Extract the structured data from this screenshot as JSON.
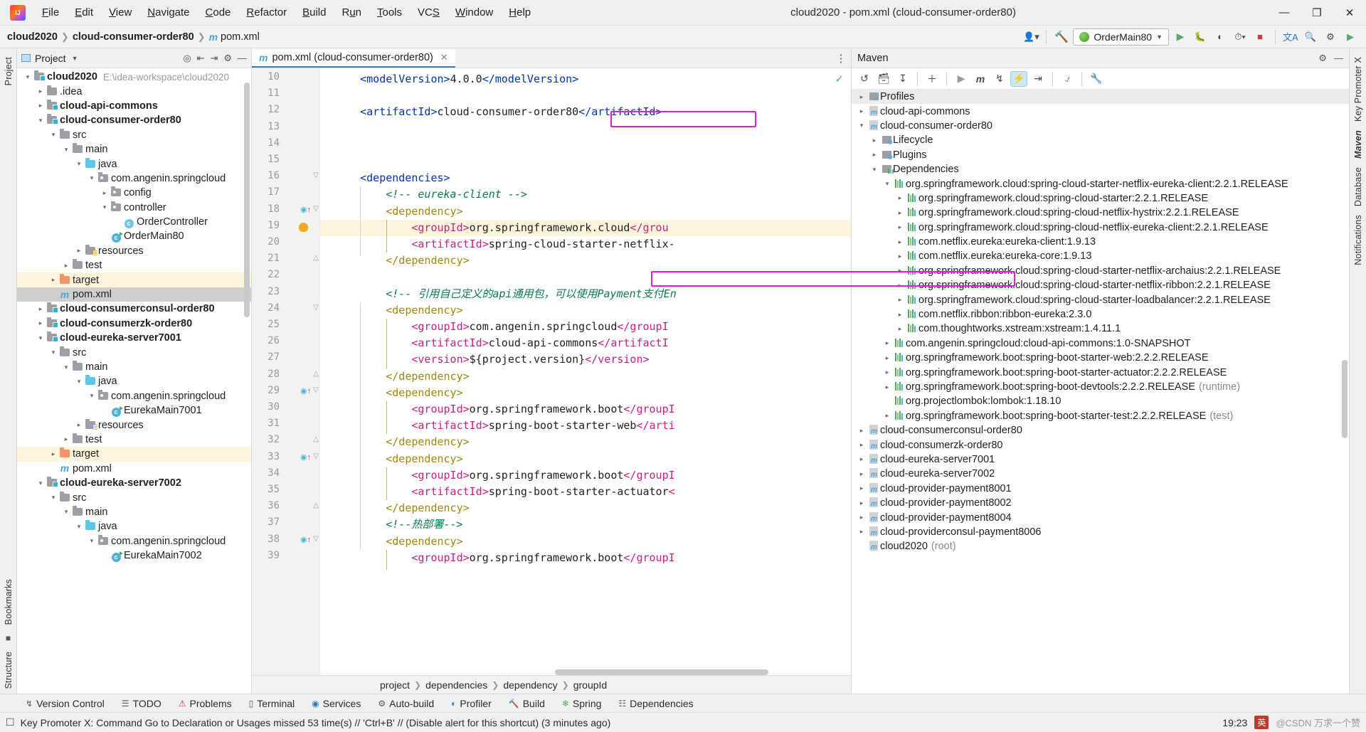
{
  "window": {
    "title": "cloud2020 - pom.xml (cloud-consumer-order80)",
    "minimize": "—",
    "maximize": "❐",
    "close": "✕"
  },
  "menubar": [
    "File",
    "Edit",
    "View",
    "Navigate",
    "Code",
    "Refactor",
    "Build",
    "Run",
    "Tools",
    "VCS",
    "Window",
    "Help"
  ],
  "navbar": {
    "crumbs": [
      "cloud2020",
      "cloud-consumer-order80",
      "pom.xml"
    ],
    "run_config": "OrderMain80",
    "icons": [
      "user-icon",
      "hammer-icon",
      "run-icon",
      "debug-icon",
      "coverage-icon",
      "profile-icon",
      "stop-icon",
      "translate-icon",
      "search-icon",
      "settings-icon",
      "expand-icon"
    ]
  },
  "rails": {
    "left_top": "Project",
    "left_bottom": "Bookmarks",
    "left_bottom2": "Structure",
    "right": [
      "Key Promoter X",
      "Maven",
      "Database",
      "Notifications"
    ]
  },
  "project_panel": {
    "title": "Project",
    "tools": [
      "target-icon",
      "collapse-icon",
      "expand-icon",
      "gear-icon",
      "hide-icon"
    ],
    "tree": [
      {
        "indent": 0,
        "arrow": "v",
        "icon": "module-folder",
        "label": "cloud2020",
        "bold": true,
        "path": "E:\\idea-workspace\\cloud2020"
      },
      {
        "indent": 1,
        "arrow": ">",
        "icon": "folder",
        "label": ".idea",
        "bold": false
      },
      {
        "indent": 1,
        "arrow": ">",
        "icon": "module-folder",
        "label": "cloud-api-commons",
        "bold": true
      },
      {
        "indent": 1,
        "arrow": "v",
        "icon": "module-folder",
        "label": "cloud-consumer-order80",
        "bold": true
      },
      {
        "indent": 2,
        "arrow": "v",
        "icon": "folder",
        "label": "src",
        "bold": false
      },
      {
        "indent": 3,
        "arrow": "v",
        "icon": "folder",
        "label": "main",
        "bold": false
      },
      {
        "indent": 4,
        "arrow": "v",
        "icon": "source-folder",
        "label": "java",
        "bold": false
      },
      {
        "indent": 5,
        "arrow": "v",
        "icon": "package",
        "label": "com.angenin.springcloud",
        "bold": false
      },
      {
        "indent": 6,
        "arrow": ">",
        "icon": "package",
        "label": "config",
        "bold": false
      },
      {
        "indent": 6,
        "arrow": "v",
        "icon": "package",
        "label": "controller",
        "bold": false
      },
      {
        "indent": 7,
        "arrow": "",
        "icon": "class",
        "label": "OrderController",
        "bold": false
      },
      {
        "indent": 6,
        "arrow": "",
        "icon": "runnable-class",
        "label": "OrderMain80",
        "bold": false
      },
      {
        "indent": 4,
        "arrow": ">",
        "icon": "resource-folder",
        "label": "resources",
        "bold": false
      },
      {
        "indent": 3,
        "arrow": ">",
        "icon": "folder",
        "label": "test",
        "bold": false
      },
      {
        "indent": 2,
        "arrow": ">",
        "icon": "target-folder",
        "label": "target",
        "bold": false,
        "highlight": true
      },
      {
        "indent": 2,
        "arrow": "",
        "icon": "maven-file",
        "label": "pom.xml",
        "bold": false,
        "selected": true
      },
      {
        "indent": 1,
        "arrow": ">",
        "icon": "module-folder",
        "label": "cloud-consumerconsul-order80",
        "bold": true
      },
      {
        "indent": 1,
        "arrow": ">",
        "icon": "module-folder",
        "label": "cloud-consumerzk-order80",
        "bold": true
      },
      {
        "indent": 1,
        "arrow": "v",
        "icon": "module-folder",
        "label": "cloud-eureka-server7001",
        "bold": true
      },
      {
        "indent": 2,
        "arrow": "v",
        "icon": "folder",
        "label": "src",
        "bold": false
      },
      {
        "indent": 3,
        "arrow": "v",
        "icon": "folder",
        "label": "main",
        "bold": false
      },
      {
        "indent": 4,
        "arrow": "v",
        "icon": "source-folder",
        "label": "java",
        "bold": false
      },
      {
        "indent": 5,
        "arrow": "v",
        "icon": "package",
        "label": "com.angenin.springcloud",
        "bold": false
      },
      {
        "indent": 6,
        "arrow": "",
        "icon": "runnable-class",
        "label": "EurekaMain7001",
        "bold": false
      },
      {
        "indent": 4,
        "arrow": ">",
        "icon": "resource-folder",
        "label": "resources",
        "bold": false
      },
      {
        "indent": 3,
        "arrow": ">",
        "icon": "folder",
        "label": "test",
        "bold": false
      },
      {
        "indent": 2,
        "arrow": ">",
        "icon": "target-folder",
        "label": "target",
        "bold": false,
        "highlight": true
      },
      {
        "indent": 2,
        "arrow": "",
        "icon": "maven-file",
        "label": "pom.xml",
        "bold": false
      },
      {
        "indent": 1,
        "arrow": "v",
        "icon": "module-folder",
        "label": "cloud-eureka-server7002",
        "bold": true
      },
      {
        "indent": 2,
        "arrow": "v",
        "icon": "folder",
        "label": "src",
        "bold": false
      },
      {
        "indent": 3,
        "arrow": "v",
        "icon": "folder",
        "label": "main",
        "bold": false
      },
      {
        "indent": 4,
        "arrow": "v",
        "icon": "source-folder",
        "label": "java",
        "bold": false
      },
      {
        "indent": 5,
        "arrow": "v",
        "icon": "package",
        "label": "com.angenin.springcloud",
        "bold": false
      },
      {
        "indent": 6,
        "arrow": "",
        "icon": "runnable-class",
        "label": "EurekaMain7002",
        "bold": false
      }
    ]
  },
  "editor": {
    "tab_label": "pom.xml (cloud-consumer-order80)",
    "tab_icon": "maven-file-icon",
    "close_icon": "✕",
    "inspection_status": "✓",
    "lines": [
      {
        "n": 10,
        "parts": [
          {
            "t": "    <modelVersion>",
            "c": "tg"
          },
          {
            "t": "4.0.0",
            "c": "txt"
          },
          {
            "t": "</modelVersion>",
            "c": "tg"
          }
        ]
      },
      {
        "n": 11,
        "parts": []
      },
      {
        "n": 12,
        "parts": [
          {
            "t": "    <artifactId>",
            "c": "tg"
          },
          {
            "t": "cloud-consumer-order80",
            "c": "txt"
          },
          {
            "t": "</artifactId>",
            "c": "tg"
          }
        ]
      },
      {
        "n": 13,
        "parts": []
      },
      {
        "n": 14,
        "parts": []
      },
      {
        "n": 15,
        "parts": []
      },
      {
        "n": 16,
        "parts": [
          {
            "t": "    <dependencies>",
            "c": "tg"
          }
        ],
        "fold": "v"
      },
      {
        "n": 17,
        "parts": [
          {
            "t": "        <!-- eureka-client -->",
            "c": "cm"
          }
        ]
      },
      {
        "n": 18,
        "parts": [
          {
            "t": "        <dependency>",
            "c": "tg2"
          }
        ],
        "mark": "bookmark-arrow",
        "fold": "v"
      },
      {
        "n": 19,
        "parts": [
          {
            "t": "            <groupId>",
            "c": "tg3"
          },
          {
            "t": "org.springframework.cloud",
            "c": "txt"
          },
          {
            "t": "</grou",
            "c": "tg3"
          }
        ],
        "bulb": true,
        "highlight": true
      },
      {
        "n": 20,
        "parts": [
          {
            "t": "            <artifactId>",
            "c": "tg3"
          },
          {
            "t": "spring-cloud-starter-netflix-",
            "c": "txt"
          }
        ]
      },
      {
        "n": 21,
        "parts": [
          {
            "t": "        </dependency>",
            "c": "tg2"
          }
        ],
        "fold": "^"
      },
      {
        "n": 22,
        "parts": []
      },
      {
        "n": 23,
        "parts": [
          {
            "t": "        <!-- 引用自己定义的api通用包，可以使用Payment支付En",
            "c": "cm"
          }
        ]
      },
      {
        "n": 24,
        "parts": [
          {
            "t": "        <dependency>",
            "c": "tg2"
          }
        ],
        "fold": "v"
      },
      {
        "n": 25,
        "parts": [
          {
            "t": "            <groupId>",
            "c": "tg3"
          },
          {
            "t": "com.angenin.springcloud",
            "c": "txt"
          },
          {
            "t": "</groupI",
            "c": "tg3"
          }
        ]
      },
      {
        "n": 26,
        "parts": [
          {
            "t": "            <artifactId>",
            "c": "tg3"
          },
          {
            "t": "cloud-api-commons",
            "c": "txt"
          },
          {
            "t": "</artifactI",
            "c": "tg3"
          }
        ]
      },
      {
        "n": 27,
        "parts": [
          {
            "t": "            <version>",
            "c": "tg3"
          },
          {
            "t": "${project.version}",
            "c": "txt"
          },
          {
            "t": "</version>",
            "c": "tg3"
          }
        ]
      },
      {
        "n": 28,
        "parts": [
          {
            "t": "        </dependency>",
            "c": "tg2"
          }
        ],
        "fold": "^"
      },
      {
        "n": 29,
        "parts": [
          {
            "t": "        <dependency>",
            "c": "tg2"
          }
        ],
        "mark": "bookmark-arrow",
        "fold": "v"
      },
      {
        "n": 30,
        "parts": [
          {
            "t": "            <groupId>",
            "c": "tg3"
          },
          {
            "t": "org.springframework.boot",
            "c": "txt"
          },
          {
            "t": "</groupI",
            "c": "tg3"
          }
        ]
      },
      {
        "n": 31,
        "parts": [
          {
            "t": "            <artifactId>",
            "c": "tg3"
          },
          {
            "t": "spring-boot-starter-web",
            "c": "txt"
          },
          {
            "t": "</arti",
            "c": "tg3"
          }
        ]
      },
      {
        "n": 32,
        "parts": [
          {
            "t": "        </dependency>",
            "c": "tg2"
          }
        ],
        "fold": "^"
      },
      {
        "n": 33,
        "parts": [
          {
            "t": "        <dependency>",
            "c": "tg2"
          }
        ],
        "mark": "bookmark-arrow",
        "fold": "v"
      },
      {
        "n": 34,
        "parts": [
          {
            "t": "            <groupId>",
            "c": "tg3"
          },
          {
            "t": "org.springframework.boot",
            "c": "txt"
          },
          {
            "t": "</groupI",
            "c": "tg3"
          }
        ]
      },
      {
        "n": 35,
        "parts": [
          {
            "t": "            <artifactId>",
            "c": "tg3"
          },
          {
            "t": "spring-boot-starter-actuator",
            "c": "txt"
          },
          {
            "t": "<",
            "c": "tg3"
          }
        ]
      },
      {
        "n": 36,
        "parts": [
          {
            "t": "        </dependency>",
            "c": "tg2"
          }
        ],
        "fold": "^"
      },
      {
        "n": 37,
        "parts": [
          {
            "t": "        <!--热部署-->",
            "c": "cm"
          }
        ]
      },
      {
        "n": 38,
        "parts": [
          {
            "t": "        <dependency>",
            "c": "tg2"
          }
        ],
        "mark": "bookmark-arrow",
        "fold": "v"
      },
      {
        "n": 39,
        "parts": [
          {
            "t": "            <groupId>",
            "c": "tg3"
          },
          {
            "t": "org.springframework.boot",
            "c": "txt"
          },
          {
            "t": "</groupI",
            "c": "tg3"
          }
        ]
      }
    ],
    "breadcrumbs": [
      "project",
      "dependencies",
      "dependency",
      "groupId"
    ]
  },
  "maven": {
    "title": "Maven",
    "head_tools": [
      "gear-icon",
      "hide-icon"
    ],
    "toolbar_icons": [
      "reload-icon",
      "generate-sources-icon",
      "download-sources-icon",
      "add-icon",
      "run-icon",
      "execute-goal-icon",
      "toggle-skip-tests-icon",
      "toggle-offline-icon",
      "collapse-all-icon",
      "show-dependencies-icon",
      "settings-wrench-icon"
    ],
    "tree": [
      {
        "indent": 0,
        "arrow": ">",
        "icon": "profiles",
        "label": "Profiles",
        "selected": true
      },
      {
        "indent": 0,
        "arrow": ">",
        "icon": "maven-module",
        "label": "cloud-api-commons"
      },
      {
        "indent": 0,
        "arrow": "v",
        "icon": "maven-module",
        "label": "cloud-consumer-order80",
        "magenta": true
      },
      {
        "indent": 1,
        "arrow": ">",
        "icon": "lifecycle",
        "label": "Lifecycle"
      },
      {
        "indent": 1,
        "arrow": ">",
        "icon": "plugins",
        "label": "Plugins"
      },
      {
        "indent": 1,
        "arrow": "v",
        "icon": "dependencies",
        "label": "Dependencies"
      },
      {
        "indent": 2,
        "arrow": "v",
        "icon": "lib",
        "label": "org.springframework.cloud:spring-cloud-starter-netflix-eureka-client:2.2.1.RELEASE"
      },
      {
        "indent": 3,
        "arrow": ">",
        "icon": "lib",
        "label": "org.springframework.cloud:spring-cloud-starter:2.2.1.RELEASE"
      },
      {
        "indent": 3,
        "arrow": ">",
        "icon": "lib",
        "label": "org.springframework.cloud:spring-cloud-netflix-hystrix:2.2.1.RELEASE"
      },
      {
        "indent": 3,
        "arrow": ">",
        "icon": "lib",
        "label": "org.springframework.cloud:spring-cloud-netflix-eureka-client:2.2.1.RELEASE"
      },
      {
        "indent": 3,
        "arrow": ">",
        "icon": "lib",
        "label": "com.netflix.eureka:eureka-client:1.9.13"
      },
      {
        "indent": 3,
        "arrow": ">",
        "icon": "lib",
        "label": "com.netflix.eureka:eureka-core:1.9.13"
      },
      {
        "indent": 3,
        "arrow": ">",
        "icon": "lib",
        "label": "org.springframework.cloud:spring-cloud-starter-netflix-archaius:2.2.1.RELEASE"
      },
      {
        "indent": 3,
        "arrow": ">",
        "icon": "lib",
        "label": "org.springframework.cloud:spring-cloud-starter-netflix-ribbon:2.2.1.RELEASE",
        "magenta": true
      },
      {
        "indent": 3,
        "arrow": ">",
        "icon": "lib",
        "label": "org.springframework.cloud:spring-cloud-starter-loadbalancer:2.2.1.RELEASE"
      },
      {
        "indent": 3,
        "arrow": ">",
        "icon": "lib",
        "label": "com.netflix.ribbon:ribbon-eureka:2.3.0"
      },
      {
        "indent": 3,
        "arrow": ">",
        "icon": "lib",
        "label": "com.thoughtworks.xstream:xstream:1.4.11.1"
      },
      {
        "indent": 2,
        "arrow": ">",
        "icon": "lib",
        "label": "com.angenin.springcloud:cloud-api-commons:1.0-SNAPSHOT"
      },
      {
        "indent": 2,
        "arrow": ">",
        "icon": "lib",
        "label": "org.springframework.boot:spring-boot-starter-web:2.2.2.RELEASE"
      },
      {
        "indent": 2,
        "arrow": ">",
        "icon": "lib",
        "label": "org.springframework.boot:spring-boot-starter-actuator:2.2.2.RELEASE"
      },
      {
        "indent": 2,
        "arrow": ">",
        "icon": "lib",
        "label": "org.springframework.boot:spring-boot-devtools:2.2.2.RELEASE",
        "dim": "(runtime)"
      },
      {
        "indent": 2,
        "arrow": "",
        "icon": "lib",
        "label": "org.projectlombok:lombok:1.18.10"
      },
      {
        "indent": 2,
        "arrow": ">",
        "icon": "lib",
        "label": "org.springframework.boot:spring-boot-starter-test:2.2.2.RELEASE",
        "dim": "(test)"
      },
      {
        "indent": 0,
        "arrow": ">",
        "icon": "maven-module",
        "label": "cloud-consumerconsul-order80"
      },
      {
        "indent": 0,
        "arrow": ">",
        "icon": "maven-module",
        "label": "cloud-consumerzk-order80"
      },
      {
        "indent": 0,
        "arrow": ">",
        "icon": "maven-module",
        "label": "cloud-eureka-server7001"
      },
      {
        "indent": 0,
        "arrow": ">",
        "icon": "maven-module",
        "label": "cloud-eureka-server7002"
      },
      {
        "indent": 0,
        "arrow": ">",
        "icon": "maven-module",
        "label": "cloud-provider-payment8001"
      },
      {
        "indent": 0,
        "arrow": ">",
        "icon": "maven-module",
        "label": "cloud-provider-payment8002"
      },
      {
        "indent": 0,
        "arrow": ">",
        "icon": "maven-module",
        "label": "cloud-provider-payment8004"
      },
      {
        "indent": 0,
        "arrow": ">",
        "icon": "maven-module",
        "label": "cloud-providerconsul-payment8006"
      },
      {
        "indent": 0,
        "arrow": "",
        "icon": "maven-module",
        "label": "cloud2020",
        "dim": "(root)"
      }
    ]
  },
  "bottom_toolwindows": [
    {
      "icon": "branch-icon",
      "label": "Version Control"
    },
    {
      "icon": "todo-icon",
      "label": "TODO"
    },
    {
      "icon": "problems-icon",
      "label": "Problems"
    },
    {
      "icon": "terminal-icon",
      "label": "Terminal"
    },
    {
      "icon": "services-icon",
      "label": "Services"
    },
    {
      "icon": "build-icon",
      "label": "Auto-build"
    },
    {
      "icon": "profiler-icon",
      "label": "Profiler"
    },
    {
      "icon": "hammer-icon",
      "label": "Build"
    },
    {
      "icon": "spring-icon",
      "label": "Spring"
    },
    {
      "icon": "dependencies-icon",
      "label": "Dependencies"
    }
  ],
  "statusbar": {
    "message": "Key Promoter X: Command Go to Declaration or Usages missed 53 time(s) // 'Ctrl+B' // (Disable alert for this shortcut) (3 minutes ago)",
    "time": "19:23",
    "ime": "英",
    "watermark": "@CSDN 万求一个赞"
  }
}
